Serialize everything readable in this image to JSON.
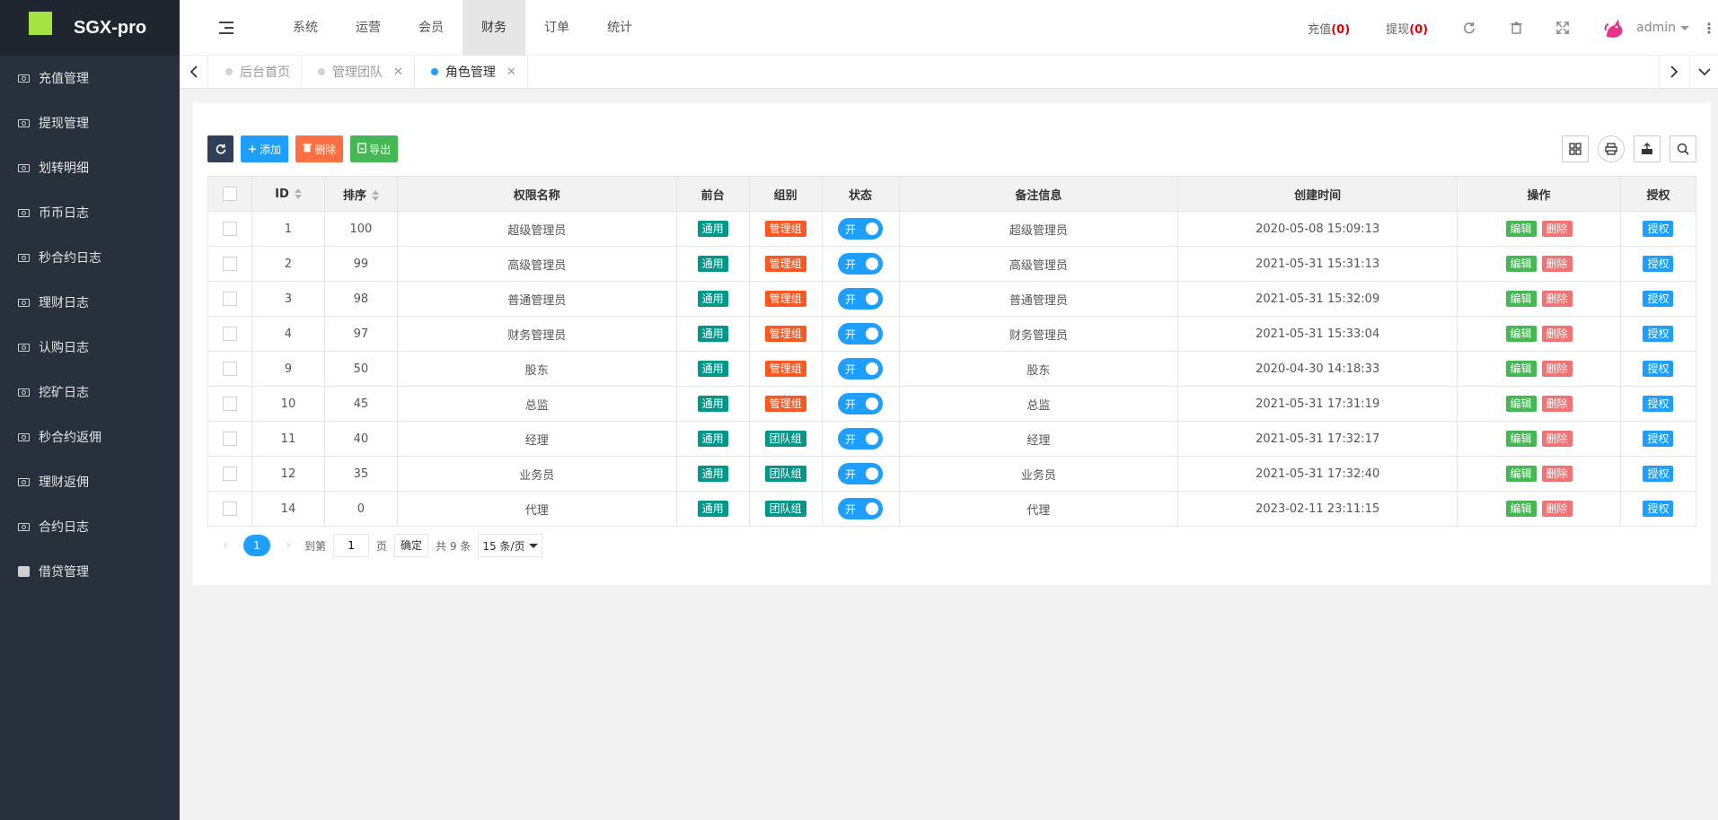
{
  "brand": {
    "name": "SGX-pro"
  },
  "sidebar": {
    "items": [
      {
        "label": "充值管理",
        "icon": "money-icon"
      },
      {
        "label": "提现管理",
        "icon": "money-icon"
      },
      {
        "label": "划转明细",
        "icon": "money-icon"
      },
      {
        "label": "币币日志",
        "icon": "money-icon"
      },
      {
        "label": "秒合约日志",
        "icon": "money-icon"
      },
      {
        "label": "理财日志",
        "icon": "money-icon"
      },
      {
        "label": "认购日志",
        "icon": "money-icon"
      },
      {
        "label": "挖矿日志",
        "icon": "money-icon"
      },
      {
        "label": "秒合约返佣",
        "icon": "money-icon"
      },
      {
        "label": "理财返佣",
        "icon": "money-icon"
      },
      {
        "label": "合约日志",
        "icon": "money-icon"
      },
      {
        "label": "借贷管理",
        "icon": "share-icon"
      }
    ]
  },
  "header": {
    "nav": [
      "系统",
      "运营",
      "会员",
      "财务",
      "订单",
      "统计"
    ],
    "active_nav": "财务",
    "recharge_label": "充值",
    "recharge_count": "(0)",
    "withdraw_label": "提现",
    "withdraw_count": "(0)",
    "username": "admin"
  },
  "tabs": [
    {
      "label": "后台首页",
      "closable": false,
      "active": false
    },
    {
      "label": "管理团队",
      "closable": true,
      "active": false
    },
    {
      "label": "角色管理",
      "closable": true,
      "active": true
    }
  ],
  "toolbar": {
    "add_label": "添加",
    "delete_label": "删除",
    "export_label": "导出"
  },
  "table": {
    "columns": [
      "ID",
      "排序",
      "权限名称",
      "前台",
      "组别",
      "状态",
      "备注信息",
      "创建时间",
      "操作",
      "授权"
    ],
    "rows": [
      {
        "id": "1",
        "sort": "100",
        "name": "超级管理员",
        "front": "通用",
        "group": "管理组",
        "status": "开",
        "remark": "超级管理员",
        "created": "2020-05-08 15:09:13"
      },
      {
        "id": "2",
        "sort": "99",
        "name": "高级管理员",
        "front": "通用",
        "group": "管理组",
        "status": "开",
        "remark": "高级管理员",
        "created": "2021-05-31 15:31:13"
      },
      {
        "id": "3",
        "sort": "98",
        "name": "普通管理员",
        "front": "通用",
        "group": "管理组",
        "status": "开",
        "remark": "普通管理员",
        "created": "2021-05-31 15:32:09"
      },
      {
        "id": "4",
        "sort": "97",
        "name": "财务管理员",
        "front": "通用",
        "group": "管理组",
        "status": "开",
        "remark": "财务管理员",
        "created": "2021-05-31 15:33:04"
      },
      {
        "id": "9",
        "sort": "50",
        "name": "股东",
        "front": "通用",
        "group": "管理组",
        "status": "开",
        "remark": "股东",
        "created": "2020-04-30 14:18:33"
      },
      {
        "id": "10",
        "sort": "45",
        "name": "总监",
        "front": "通用",
        "group": "管理组",
        "status": "开",
        "remark": "总监",
        "created": "2021-05-31 17:31:19"
      },
      {
        "id": "11",
        "sort": "40",
        "name": "经理",
        "front": "通用",
        "group": "团队组",
        "status": "开",
        "remark": "经理",
        "created": "2021-05-31 17:32:17"
      },
      {
        "id": "12",
        "sort": "35",
        "name": "业务员",
        "front": "通用",
        "group": "团队组",
        "status": "开",
        "remark": "业务员",
        "created": "2021-05-31 17:32:40"
      },
      {
        "id": "14",
        "sort": "0",
        "name": "代理",
        "front": "通用",
        "group": "团队组",
        "status": "开",
        "remark": "代理",
        "created": "2023-02-11 23:11:15"
      }
    ],
    "edit_label": "编辑",
    "delete_label": "删除",
    "auth_label": "授权"
  },
  "pager": {
    "current": "1",
    "goto_label": "到第",
    "page_input": "1",
    "page_unit": "页",
    "confirm_label": "确定",
    "total_label": "共 9 条",
    "page_size": "15 条/页"
  },
  "colors": {
    "sidebar_bg": "#28303b",
    "accent": "#1e9fff",
    "teal": "#009688",
    "orange": "#ff5722",
    "green": "#45b854",
    "count_red": "#e10000"
  }
}
